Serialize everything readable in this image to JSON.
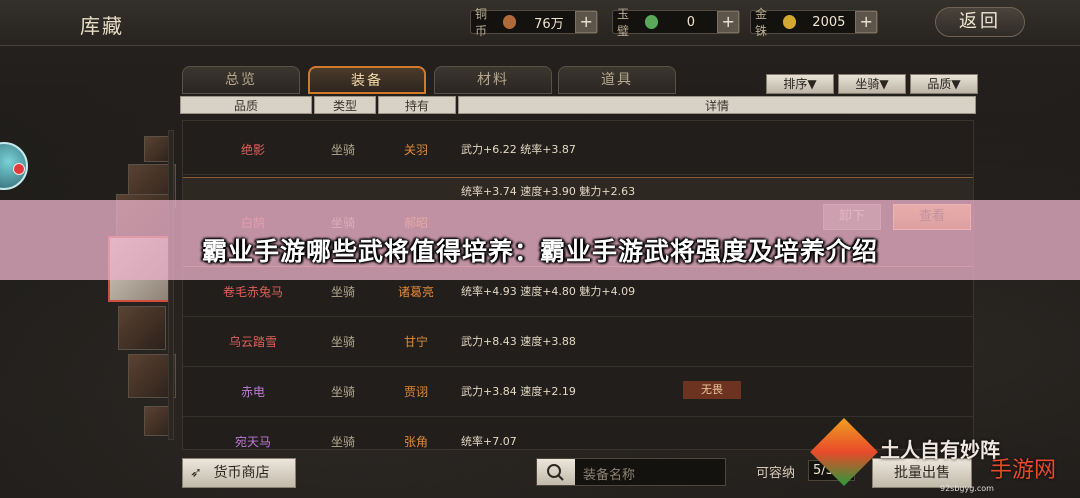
{
  "header": {
    "title": "库藏",
    "back_label": "返回",
    "currencies": [
      {
        "name": "铜币",
        "value": "76万",
        "coin_color": "#b06a3a"
      },
      {
        "name": "玉璧",
        "value": "0",
        "coin_color": "#5aa85a"
      },
      {
        "name": "金铢",
        "value": "2005",
        "coin_color": "#d2a732"
      }
    ],
    "plus_label": "+"
  },
  "tabs": [
    {
      "label": "总览",
      "active": false
    },
    {
      "label": "装备",
      "active": true
    },
    {
      "label": "材料",
      "active": false
    },
    {
      "label": "道具",
      "active": false
    }
  ],
  "filters": [
    "排序▼",
    "坐骑▼",
    "品质▼"
  ],
  "table": {
    "headers": [
      "品质",
      "类型",
      "持有",
      "详情"
    ],
    "rows": [
      {
        "name": "绝影",
        "quality": "red",
        "type": "坐骑",
        "owner": "关羽",
        "detail": "武力+6.22  统率+3.87",
        "tag": ""
      },
      {
        "name": "白鹄",
        "quality": "red",
        "type": "坐骑",
        "owner": "郝昭",
        "detail": "统率+3.74  速度+3.90  魅力+2.63",
        "tag": "",
        "selected": true
      },
      {
        "name": "卷毛赤兔马",
        "quality": "red",
        "type": "坐骑",
        "owner": "诸葛亮",
        "detail": "统率+4.93  速度+4.80  魅力+4.09",
        "tag": ""
      },
      {
        "name": "乌云踏雪",
        "quality": "red",
        "type": "坐骑",
        "owner": "甘宁",
        "detail": "武力+8.43  速度+3.88",
        "tag": ""
      },
      {
        "name": "赤电",
        "quality": "purple",
        "type": "坐骑",
        "owner": "贾诩",
        "detail": "武力+3.84  速度+2.19",
        "tag": "无畏"
      },
      {
        "name": "宛天马",
        "quality": "purple",
        "type": "坐骑",
        "owner": "张角",
        "detail": "统率+7.07",
        "tag": ""
      }
    ],
    "unload_label": "卸下",
    "view_label": "查看"
  },
  "footer": {
    "shop_label": "货币商店",
    "search_placeholder": "装备名称",
    "capacity_label": "可容纳",
    "capacity_value": "5/300",
    "batch_sell_label": "批量出售"
  },
  "banner": {
    "title": "霸业手游哪些武将值得培养：霸业手游武将强度及培养介绍"
  },
  "watermark": {
    "slogan": "土人自有妙阵",
    "brand": "手游网",
    "url": "92sbgyg.com"
  }
}
